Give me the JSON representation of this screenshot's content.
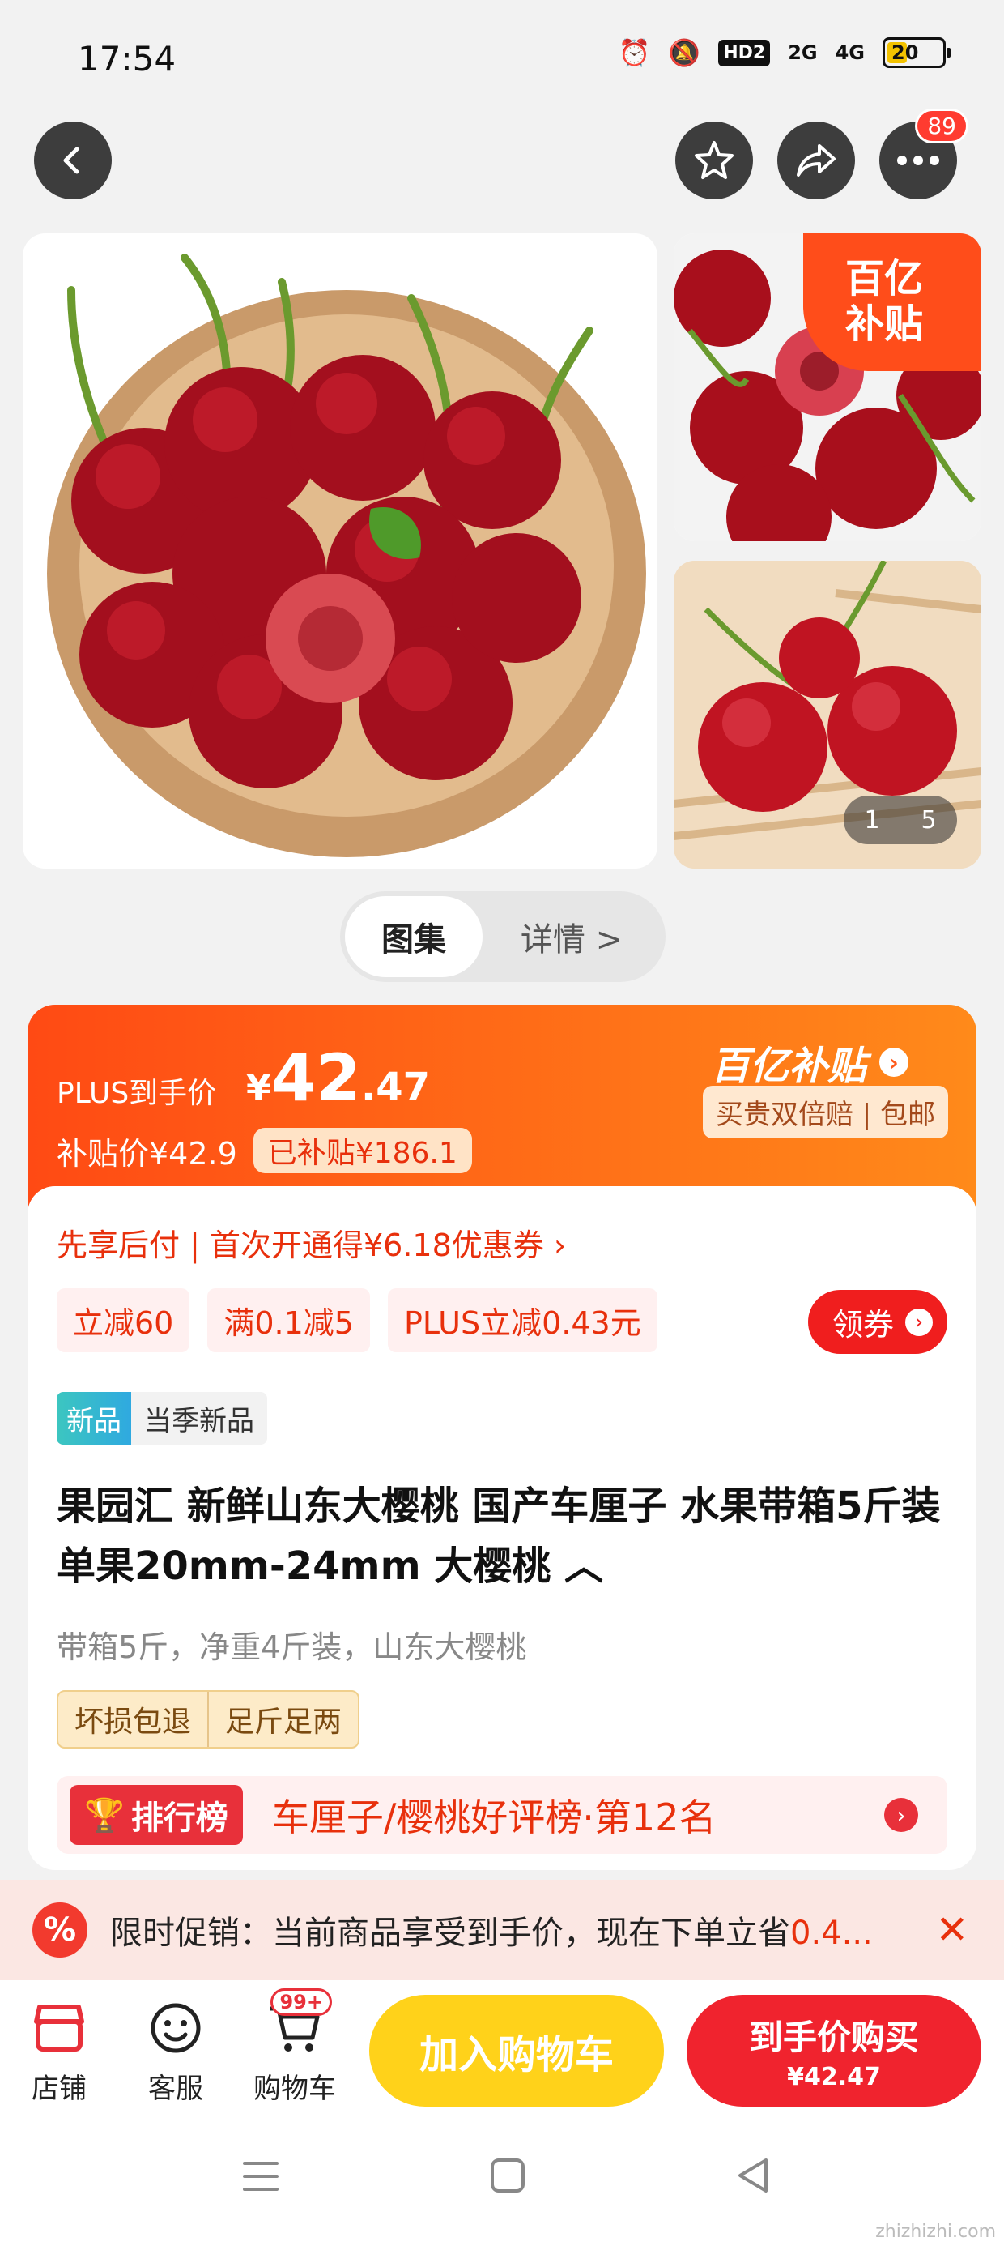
{
  "status_bar": {
    "time": "17:54",
    "hd": "HD2",
    "net1": "2G",
    "net2": "4G",
    "battery": "20"
  },
  "nav": {
    "menu_badge": "89"
  },
  "gallery": {
    "current": "1",
    "total": "5",
    "subsidy_line1": "百亿",
    "subsidy_line2": "补贴"
  },
  "tabs": {
    "active": "图集",
    "inactive": "详情 >"
  },
  "price": {
    "plus_label": "PLUS到手价",
    "currency": "¥",
    "integer": "42",
    "decimal": ".47",
    "subsidy_price": "补贴价¥42.9",
    "subsidized_tag": "已补贴¥186.1",
    "brand": "百亿补贴",
    "brand_tag": "买贵双倍赔 | 包邮"
  },
  "offers": {
    "first_pay": "先享后付 | 首次开通得¥6.18优惠券 ›",
    "coupons": [
      "立减60",
      "满0.1减5",
      "PLUS立减0.43元"
    ],
    "get_coupon": "领券"
  },
  "product": {
    "new_tag": "新品",
    "new_tag_text": "当季新品",
    "title": "果园汇 新鲜山东大樱桃 国产车厘子 水果带箱5斤装单果20mm-24mm 大樱桃 ︿",
    "subtitle": "带箱5斤，净重4斤装，山东大樱桃",
    "guarantees": [
      "坏损包退",
      "足斤足两"
    ],
    "rank_badge": "排行榜",
    "rank_text": "车厘子/樱桃好评榜·第12名"
  },
  "promo": {
    "icon": "%",
    "label": "限时促销：当前商品享受到手价，现在下单立省",
    "highlight": "0.4...",
    "close": "✕"
  },
  "bottom_bar": {
    "shop": "店铺",
    "service": "客服",
    "cart": "购物车",
    "cart_badge": "99+",
    "add_cart": "加入购物车",
    "buy_line1": "到手价购买",
    "buy_line2": "¥42.47"
  },
  "watermark": "zhizhizhi.com"
}
